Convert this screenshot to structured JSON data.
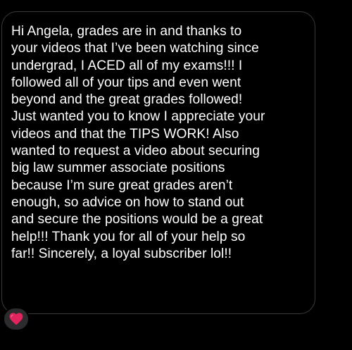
{
  "message": {
    "lines": [
      "Hi Angela, grades are in and thanks to",
      "your videos that I’ve been watching since",
      "undergrad, I ACED all of my exams!!! I",
      "followed all of your tips and even went",
      "beyond and the great grades followed!",
      "Just wanted you to know I appreciate your",
      "videos and that the TIPS WORK! Also",
      "wanted to request a video about securing",
      "big law summer associate positions",
      "because I’m sure great grades aren’t",
      "enough, so advice on how to stand out",
      "and secure the positions would be a great",
      "help!!! Thank you for all of your help so",
      "far!! Sincerely, a loyal subscriber lol!!"
    ]
  },
  "reaction": {
    "icon": "red-heart-icon",
    "color": "#e0245e"
  },
  "colors": {
    "background": "#000000",
    "bubble_border": "#3a3a3c",
    "text": "#ffffff",
    "reaction_background": "#2c2c2e"
  }
}
